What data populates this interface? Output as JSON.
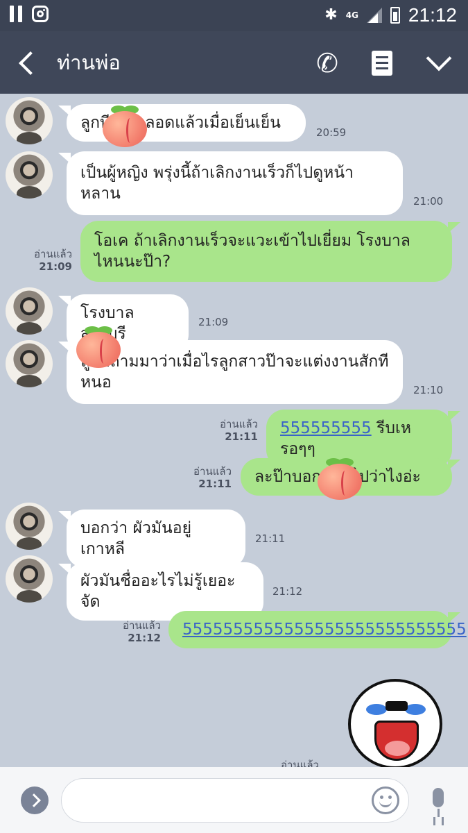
{
  "status_bar": {
    "time": "21:12",
    "network": "4G",
    "icons": [
      "pause-icon",
      "instagram-icon",
      "bluetooth-icon",
      "signal-icon",
      "battery-icon"
    ]
  },
  "header": {
    "title": "ท่านพ่อ",
    "back_icon": "chevron-left-icon",
    "call_icon": "phone-icon",
    "notes_icon": "notes-icon",
    "menu_icon": "chevron-down-icon"
  },
  "messages": [
    {
      "dir": "in",
      "text": "ลูกบี ลูกคลอดแล้วเมื่อเย็นเย็น",
      "time": "20:59"
    },
    {
      "dir": "in",
      "text": "เป็นผู้หญิง พรุ่งนี้ถ้าเลิกงานเร็วก็ไปดูหน้าหลาน",
      "time": "21:00"
    },
    {
      "dir": "out",
      "text": "โอเค ถ้าเลิกงานเร็วจะแวะเข้าไปเยี่ยม โรงบาลไหนนะป๊า?",
      "read": "อ่านแล้ว",
      "time": "21:09"
    },
    {
      "dir": "in",
      "text": "โรงบาลสระบุรี",
      "time": "21:09"
    },
    {
      "dir": "in",
      "text": "ลูกบีถามมาว่าเมื่อไรลูกสาวป๊าจะแต่งงานสักทีหนอ",
      "time": "21:10"
    },
    {
      "dir": "out",
      "link": "555555555",
      "text": " รีบเหรอๆๆ",
      "read": "อ่านแล้ว",
      "time": "21:11"
    },
    {
      "dir": "out",
      "text": "ละป๊าบอกลูกบีไปว่าไงอ่ะ",
      "read": "อ่านแล้ว",
      "time": "21:11"
    },
    {
      "dir": "in",
      "text": "บอกว่า ผัวมันอยู่เกาหลี",
      "time": "21:11"
    },
    {
      "dir": "in",
      "text": "ผัวมันชื่ออะไรไม่รู้เยอะจัด",
      "time": "21:12"
    },
    {
      "dir": "out",
      "link": "5555555555555555555555555555",
      "read": "อ่านแล้ว",
      "time": "21:12"
    }
  ],
  "sticker": {
    "name": "crying-laughing-sticker",
    "read": "อ่านแล้ว"
  },
  "input_bar": {
    "placeholder": "",
    "expand_icon": "chevron-right-icon",
    "emoji_icon": "emoji-icon",
    "mic_icon": "microphone-icon"
  },
  "colors": {
    "header_bg": "#3f4759",
    "chat_bg": "#c5cdd9",
    "incoming_bubble": "#ffffff",
    "outgoing_bubble": "#a9e58b",
    "link": "#3a63c8"
  }
}
